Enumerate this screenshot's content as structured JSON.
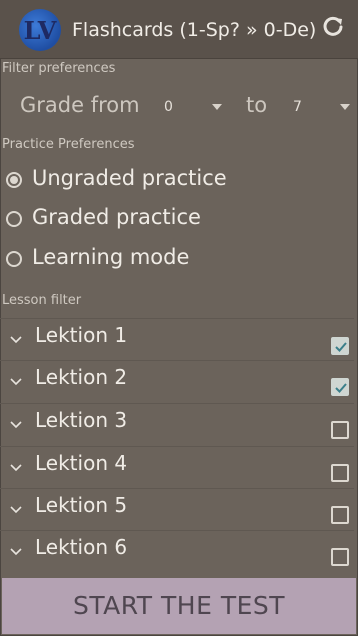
{
  "header": {
    "logo_text": "LV",
    "title": "Flashcards (1-Sp? » 0-De)"
  },
  "filter": {
    "section_label": "Filter preferences",
    "grade_from_label": "Grade from",
    "grade_from_value": "0",
    "grade_to_label": "to",
    "grade_to_value": "7"
  },
  "practice": {
    "section_label": "Practice Preferences",
    "options": [
      {
        "label": "Ungraded practice",
        "selected": true
      },
      {
        "label": "Graded practice",
        "selected": false
      },
      {
        "label": "Learning mode",
        "selected": false
      }
    ]
  },
  "lessons": {
    "section_label": "Lesson filter",
    "items": [
      {
        "label": "Lektion 1",
        "checked": true
      },
      {
        "label": "Lektion 2",
        "checked": true
      },
      {
        "label": "Lektion 3",
        "checked": false
      },
      {
        "label": "Lektion 4",
        "checked": false
      },
      {
        "label": "Lektion 5",
        "checked": false
      },
      {
        "label": "Lektion 6",
        "checked": false
      }
    ]
  },
  "footer": {
    "start_label": "START THE TEST"
  },
  "icons": {
    "refresh": "refresh-icon",
    "chevron": "chevron-down-icon",
    "caret": "dropdown-caret-icon"
  },
  "colors": {
    "background": "#6b635b",
    "titlebar": "#5a524b",
    "button": "#b4a2b3",
    "checkbox_checked": "#cfd6d2"
  }
}
